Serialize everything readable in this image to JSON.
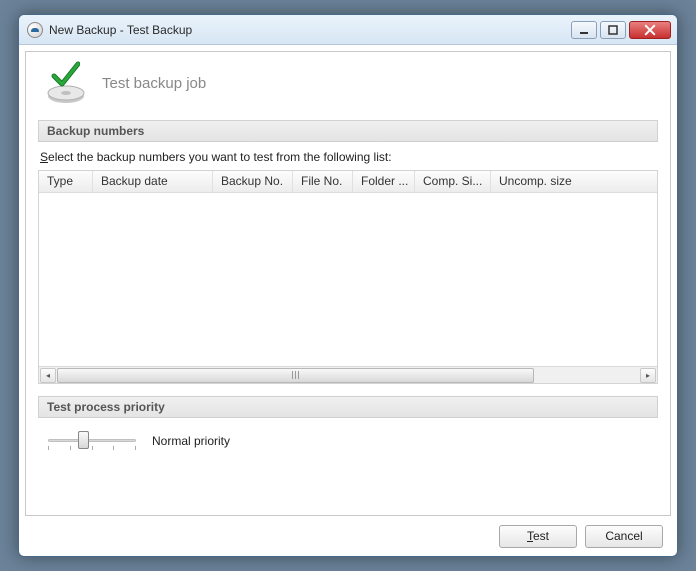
{
  "window": {
    "title": "New Backup - Test Backup"
  },
  "header": {
    "heading": "Test backup job"
  },
  "sections": {
    "backup_numbers_title": "Backup numbers",
    "instruction_pre": "S",
    "instruction_post": "elect the backup numbers you want to test from the following list:",
    "priority_title": "Test process priority"
  },
  "table": {
    "columns": [
      "Type",
      "Backup date",
      "Backup No.",
      "File No.",
      "Folder ...",
      "Comp. Si...",
      "Uncomp. size"
    ],
    "rows": []
  },
  "priority": {
    "label": "Normal priority"
  },
  "buttons": {
    "test_pre": "T",
    "test_post": "est",
    "cancel": "Cancel"
  }
}
